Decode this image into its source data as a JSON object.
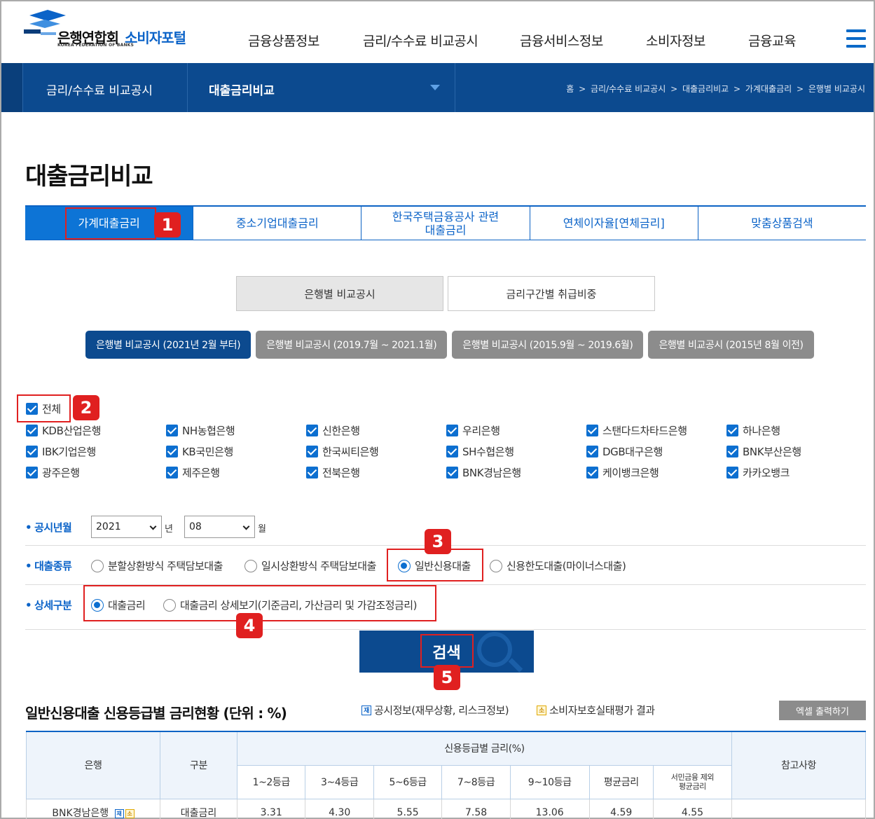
{
  "header": {
    "org_name": "은행연합회",
    "org_name_en": "KOREA FEDERATION OF BANKS",
    "portal": "소비자포털",
    "menu": [
      "금융상품정보",
      "금리/수수료 비교공시",
      "금융서비스정보",
      "소비자정보",
      "금융교육"
    ]
  },
  "navbar": {
    "section": "금리/수수료 비교공시",
    "current": "대출금리비교",
    "breadcrumb": [
      "홈",
      "금리/수수료 비교공시",
      "대출금리비교",
      "가계대출금리",
      "은행별 비교공시"
    ]
  },
  "page_title": "대출금리비교",
  "tabs": [
    {
      "label": "가계대출금리",
      "active": true
    },
    {
      "label": "중소기업대출금리",
      "active": false
    },
    {
      "label": "한국주택금융공사 관련\n대출금리",
      "active": false
    },
    {
      "label": "연체이자율[연체금리]",
      "active": false
    },
    {
      "label": "맞춤상품검색",
      "active": false
    }
  ],
  "subtabs": [
    {
      "label": "은행별 비교공시",
      "active": true
    },
    {
      "label": "금리구간별 취급비중",
      "active": false
    }
  ],
  "periods": [
    {
      "label": "은행별 비교공시 (2021년 2월 부터)",
      "active": true
    },
    {
      "label": "은행별 비교공시 (2019.7월 ~ 2021.1월)",
      "active": false
    },
    {
      "label": "은행별 비교공시 (2015.9월 ~ 2019.6월)",
      "active": false
    },
    {
      "label": "은행별 비교공시 (2015년 8월 이전)",
      "active": false
    }
  ],
  "all_checkbox": "전체",
  "banks": [
    "KDB산업은행",
    "NH농협은행",
    "신한은행",
    "우리은행",
    "스탠다드차타드은행",
    "하나은행",
    "IBK기업은행",
    "KB국민은행",
    "한국씨티은행",
    "SH수협은행",
    "DGB대구은행",
    "BNK부산은행",
    "광주은행",
    "제주은행",
    "전북은행",
    "BNK경남은행",
    "케이뱅크은행",
    "카카오뱅크"
  ],
  "form": {
    "date_label": "공시년월",
    "year": "2021",
    "year_unit": "년",
    "month": "08",
    "month_unit": "월",
    "loan_type_label": "대출종류",
    "loan_types": [
      {
        "label": "분할상환방식 주택담보대출",
        "checked": false
      },
      {
        "label": "일시상환방식 주택담보대출",
        "checked": false
      },
      {
        "label": "일반신용대출",
        "checked": true
      },
      {
        "label": "신용한도대출(마이너스대출)",
        "checked": false
      }
    ],
    "detail_label": "상세구분",
    "details": [
      {
        "label": "대출금리",
        "checked": true
      },
      {
        "label": "대출금리 상세보기(기준금리, 가산금리 및 가감조정금리)",
        "checked": false
      }
    ],
    "search_label": "검색"
  },
  "annotations": [
    "1",
    "2",
    "3",
    "4",
    "5"
  ],
  "results": {
    "title": "일반신용대출 신용등급별 금리현황 (단위 : %)",
    "legend_disclosure_icon": "재",
    "legend_disclosure": "공시정보(재무상황, 리스크정보)",
    "legend_consumer_icon": "소",
    "legend_consumer": "소비자보호실태평가 결과",
    "excel_button": "엑셀 출력하기",
    "table": {
      "col_bank": "은행",
      "col_type": "구분",
      "col_group": "신용등급별 금리(%)",
      "col_note": "참고사항",
      "grades": [
        "1~2등급",
        "3~4등급",
        "5~6등급",
        "7~8등급",
        "9~10등급",
        "평균금리"
      ],
      "grade_excl_line1": "서민금융 제외",
      "grade_excl_line2": "평균금리",
      "rows": [
        {
          "bank": "BNK경남은행",
          "type": "대출금리",
          "values": [
            "3.31",
            "4.30",
            "5.55",
            "7.58",
            "13.06",
            "4.59",
            "4.55"
          ],
          "note": ""
        }
      ]
    }
  },
  "colors": {
    "brand_blue": "#0c4a8f",
    "accent_blue": "#0d74d6",
    "annotation_red": "#e02020"
  }
}
